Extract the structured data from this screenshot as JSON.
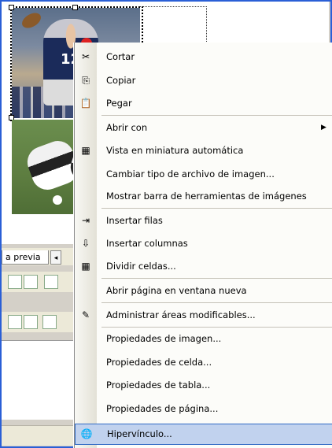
{
  "background_tab": {
    "label": "a previa",
    "nav_glyph": "◂"
  },
  "photo": {
    "jersey_number": "12"
  },
  "context_menu": {
    "items": [
      {
        "id": "cortar",
        "label": "Cortar",
        "icon": "scissors-icon",
        "glyph": "✂"
      },
      {
        "id": "copiar",
        "label": "Copiar",
        "icon": "copy-icon",
        "glyph": "⎘"
      },
      {
        "id": "pegar",
        "label": "Pegar",
        "icon": "paste-icon",
        "glyph": "📋"
      },
      {
        "id": "abrir-con",
        "label": "Abrir con",
        "icon": "",
        "glyph": "",
        "submenu_glyph": "▶"
      },
      {
        "id": "vista-miniatura",
        "label": "Vista en miniatura automática",
        "icon": "thumbnail-icon",
        "glyph": "▦"
      },
      {
        "id": "cambiar-tipo",
        "label": "Cambiar tipo de archivo de imagen...",
        "icon": "",
        "glyph": ""
      },
      {
        "id": "mostrar-barra",
        "label": "Mostrar barra de herramientas de imágenes",
        "icon": "",
        "glyph": ""
      },
      {
        "id": "insertar-filas",
        "label": "Insertar filas",
        "icon": "insert-rows-icon",
        "glyph": "⇥"
      },
      {
        "id": "insertar-columnas",
        "label": "Insertar columnas",
        "icon": "insert-columns-icon",
        "glyph": "⇩"
      },
      {
        "id": "dividir-celdas",
        "label": "Dividir celdas...",
        "icon": "split-cells-icon",
        "glyph": "▦"
      },
      {
        "id": "abrir-pagina",
        "label": "Abrir página en ventana nueva",
        "icon": "",
        "glyph": ""
      },
      {
        "id": "administrar-areas",
        "label": "Administrar áreas modificables...",
        "icon": "editable-areas-icon",
        "glyph": "✎"
      },
      {
        "id": "prop-imagen",
        "label": "Propiedades de imagen...",
        "icon": "",
        "glyph": ""
      },
      {
        "id": "prop-celda",
        "label": "Propiedades de celda...",
        "icon": "",
        "glyph": ""
      },
      {
        "id": "prop-tabla",
        "label": "Propiedades de tabla...",
        "icon": "",
        "glyph": ""
      },
      {
        "id": "prop-pagina",
        "label": "Propiedades de página...",
        "icon": "",
        "glyph": ""
      },
      {
        "id": "hipervinculo",
        "label": "Hipervínculo...",
        "icon": "hyperlink-icon",
        "glyph": "🌐",
        "highlighted": true
      }
    ]
  },
  "colors": {
    "frame": "#2a5fd6",
    "highlight_bg": "#c1d2ee",
    "highlight_border": "#316ac5"
  }
}
